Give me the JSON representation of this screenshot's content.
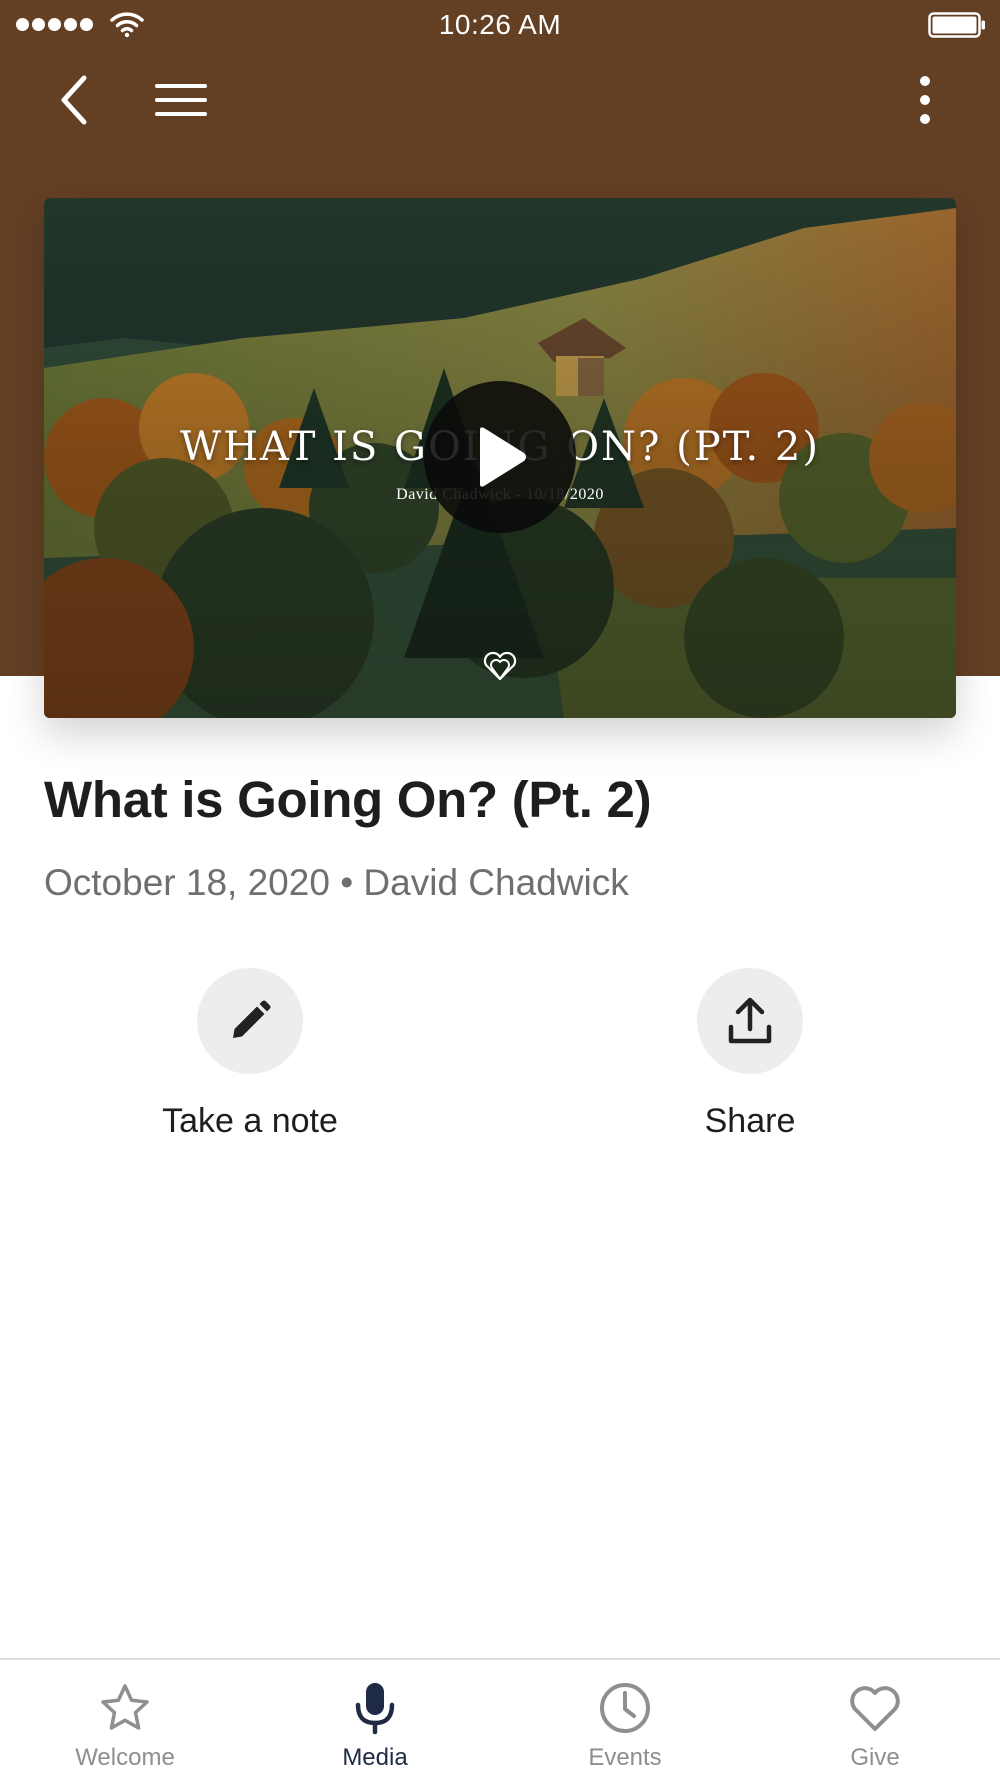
{
  "status_bar": {
    "time": "10:26 AM",
    "signal_icon": "signal-dots-icon",
    "wifi_icon": "wifi-icon",
    "battery_icon": "battery-icon"
  },
  "nav": {
    "back_icon": "chevron-left-icon",
    "menu_icon": "hamburger-menu-icon",
    "more_icon": "more-vertical-icon"
  },
  "colors": {
    "header_brown": "#633f24",
    "tab_active": "#1f2a44",
    "tab_inactive": "#8e8e93",
    "meta_gray": "#6e6e73"
  },
  "video": {
    "overlay_title": "WHAT IS GOING ON? (PT. 2)",
    "overlay_subtitle": "David Chadwick - 10/18/2020",
    "play_icon": "play-icon"
  },
  "media": {
    "title": "What is Going On? (Pt. 2)",
    "meta": "October 18, 2020 • David Chadwick"
  },
  "actions": [
    {
      "label": "Take a note",
      "icon": "pencil-icon"
    },
    {
      "label": "Share",
      "icon": "share-upload-icon"
    }
  ],
  "tabs": [
    {
      "label": "Welcome",
      "icon": "star-icon",
      "active": false
    },
    {
      "label": "Media",
      "icon": "microphone-icon",
      "active": true
    },
    {
      "label": "Events",
      "icon": "clock-icon",
      "active": false
    },
    {
      "label": "Give",
      "icon": "heart-icon",
      "active": false
    }
  ]
}
